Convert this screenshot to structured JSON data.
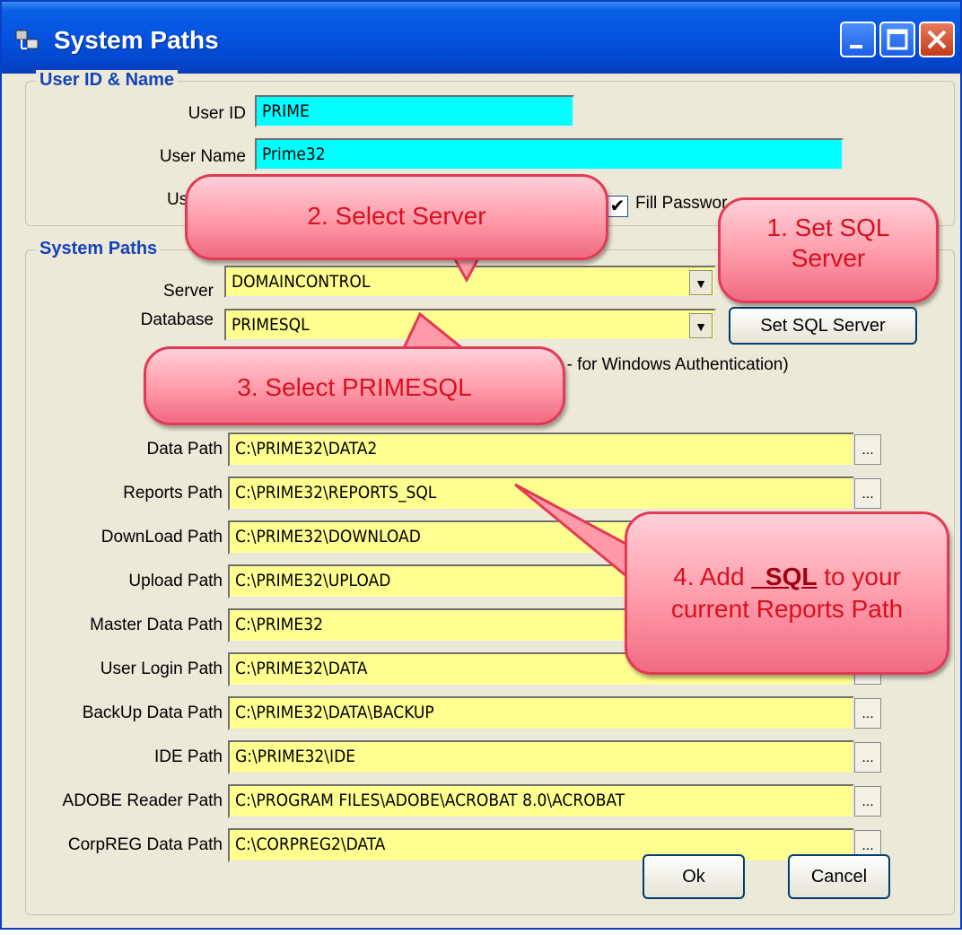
{
  "window": {
    "title": "System Paths"
  },
  "user_group": {
    "legend": "User ID & Name",
    "user_id": {
      "label": "User ID",
      "value": "PRIME"
    },
    "user_name": {
      "label": "User Name",
      "value": "Prime32"
    },
    "user_password": {
      "label": "User Pas"
    },
    "fill_password": {
      "label": "Fill Passwor",
      "checked": true
    }
  },
  "system_group": {
    "legend": "System Paths",
    "server": {
      "label": "Server",
      "value": "DOMAINCONTROL"
    },
    "database": {
      "label": "Database",
      "value": "PRIMESQL"
    },
    "set_sql_button": "Set SQL Server",
    "auth_note": "No - for Windows Authentication)",
    "paths": [
      {
        "label": "Data Path",
        "value": "C:\\PRIME32\\DATA2"
      },
      {
        "label": "Reports Path",
        "value": "C:\\PRIME32\\REPORTS_SQL"
      },
      {
        "label": "DownLoad Path",
        "value": "C:\\PRIME32\\DOWNLOAD"
      },
      {
        "label": "Upload Path",
        "value": "C:\\PRIME32\\UPLOAD"
      },
      {
        "label": "Master Data Path",
        "value": "C:\\PRIME32"
      },
      {
        "label": "User Login Path",
        "value": "C:\\PRIME32\\DATA"
      },
      {
        "label": "BackUp Data Path",
        "value": "C:\\PRIME32\\DATA\\BACKUP"
      },
      {
        "label": "IDE Path",
        "value": "G:\\PRIME32\\IDE"
      },
      {
        "label": "ADOBE Reader Path",
        "value": "C:\\PROGRAM FILES\\ADOBE\\ACROBAT 8.0\\ACROBAT"
      },
      {
        "label": "CorpREG Data Path",
        "value": "C:\\CORPREG2\\DATA"
      }
    ],
    "browse_label": "..."
  },
  "buttons": {
    "ok": "Ok",
    "cancel": "Cancel"
  },
  "callouts": {
    "c1_line1": "1. Set SQL",
    "c1_line2": "Server",
    "c2": "2. Select Server",
    "c3": "3. Select PRIMESQL",
    "c4_prefix": "4. Add ",
    "c4_bold": "_SQL",
    "c4_suffix": " to your",
    "c4_line2": "current Reports Path"
  },
  "colors": {
    "required_field": "#00ffff",
    "path_field": "#ffff90",
    "callout": "#ff9aa8",
    "callout_text": "#d81020"
  }
}
